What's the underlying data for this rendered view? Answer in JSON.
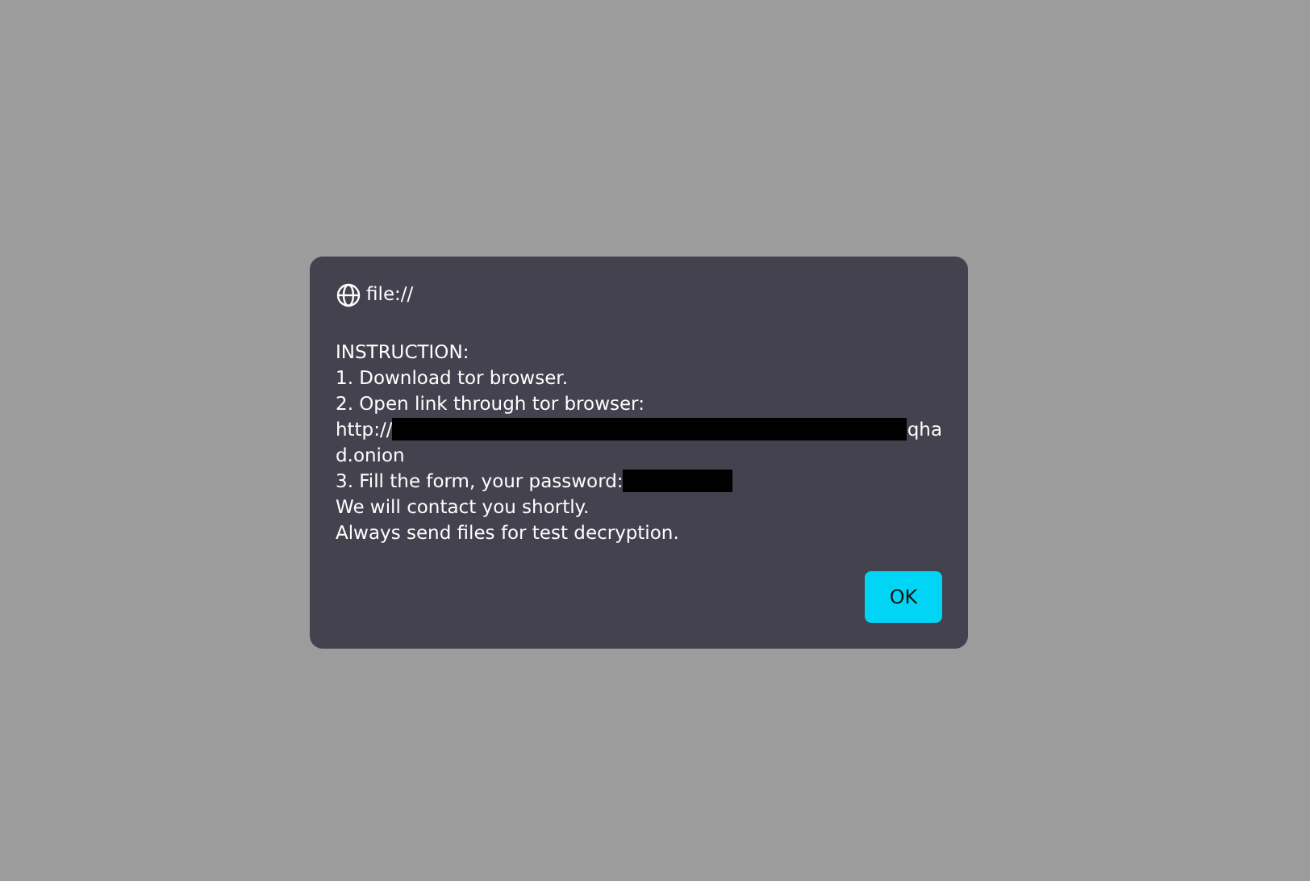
{
  "dialog": {
    "origin": "file://",
    "lines": [
      {
        "text": "INSTRUCTION:"
      },
      {
        "text": "1. Download tor browser."
      },
      {
        "text": "2. Open link through tor browser:"
      },
      {
        "text": "http://",
        "kind": "url",
        "after": "qha"
      },
      {
        "text": "d.onion"
      },
      {
        "text": "3. Fill the form, your password:",
        "kind": "password"
      },
      {
        "text": "We will contact you shortly."
      },
      {
        "text": "Always send files for test decryption."
      }
    ],
    "button": "OK"
  }
}
